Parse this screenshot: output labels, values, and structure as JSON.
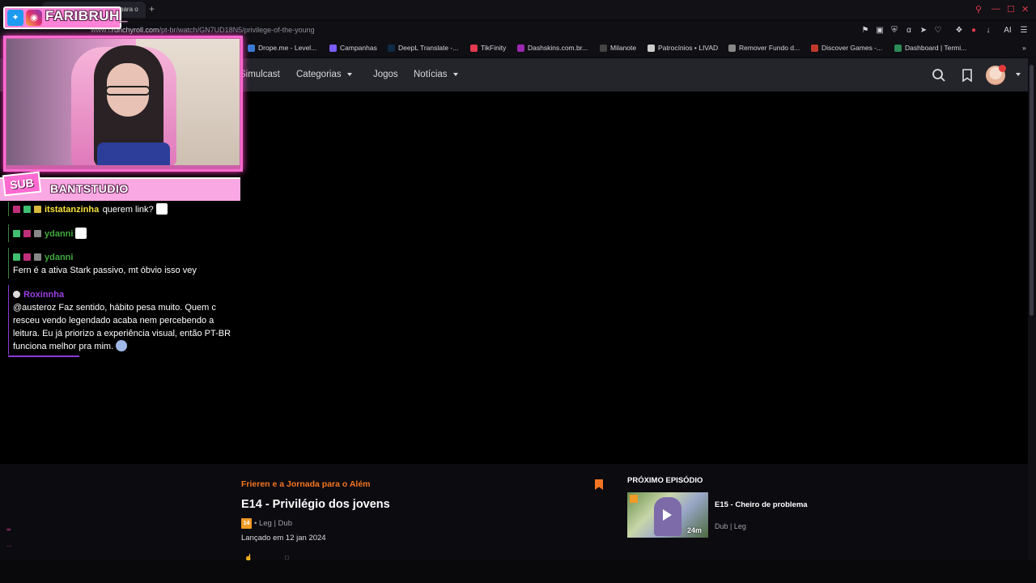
{
  "browser": {
    "tab_title": "para o",
    "url_prefix": "www.c",
    "url_domain": "runchyroll.com",
    "url_path": "/pt-br/watch/GN7UD18N5/privilege-of-the-young",
    "extensions_label": "AI"
  },
  "bookmarks": [
    {
      "label": "Drope.me - Level...",
      "color": "#3a7bd5"
    },
    {
      "label": "Campanhas",
      "color": "#7b5cff"
    },
    {
      "label": "DeepL Translate -...",
      "color": "#0f2b46"
    },
    {
      "label": "TikFinity",
      "color": "#e5394d"
    },
    {
      "label": "Dashskins.com.br...",
      "color": "#9c27b0"
    },
    {
      "label": "Milanote",
      "color": "#444"
    },
    {
      "label": "Patrocínios • LIVAD",
      "color": "#ccc"
    },
    {
      "label": "Remover Fundo d...",
      "color": "#888"
    },
    {
      "label": "Discover Games -...",
      "color": "#c0392b"
    },
    {
      "label": "Dashboard | Termi...",
      "color": "#2e8b57"
    }
  ],
  "nav": {
    "simulcast": "Simulcast",
    "categorias": "Categorias",
    "jogos": "Jogos",
    "noticias": "Notícias"
  },
  "overlay": {
    "social_handle": "FARIBRUH_",
    "sub_tag": "SUB",
    "sub_name": "BANTSTUDIO"
  },
  "chat": [
    {
      "user": "itstatanzinha",
      "user_color": "#f6e23b",
      "text": "querem link?"
    },
    {
      "user": "ydanni",
      "user_color": "#3faa3f",
      "text": ""
    },
    {
      "user": "ydanni",
      "user_color": "#3faa3f",
      "text": "Fern é a ativa Stark passivo, mt óbvio isso vey"
    },
    {
      "user": "Roxinnha",
      "user_color": "#9b3fe0",
      "text": "@austeroz Faz sentido, hábito pesa muito. Quem c resceu vendo legendado acaba nem percebendo a leitura. Eu já priorizo a experiência visual, então PT-BR funciona melhor pra mim."
    }
  ],
  "episode": {
    "series": "Frieren e a Jornada para o Além",
    "title": "E14 - Privilégio dos jovens",
    "rating_badge": "14",
    "audio": "• Leg | Dub",
    "released": "Lançado em 12 jan 2024"
  },
  "next_episode": {
    "heading": "PRÓXIMO EPISÓDIO",
    "title": "E15 - Cheiro de problema",
    "duration": "24m",
    "audio": "Dub | Leg"
  },
  "colors": {
    "accent": "#f47521",
    "overlay_pink": "#ff6ad1"
  }
}
